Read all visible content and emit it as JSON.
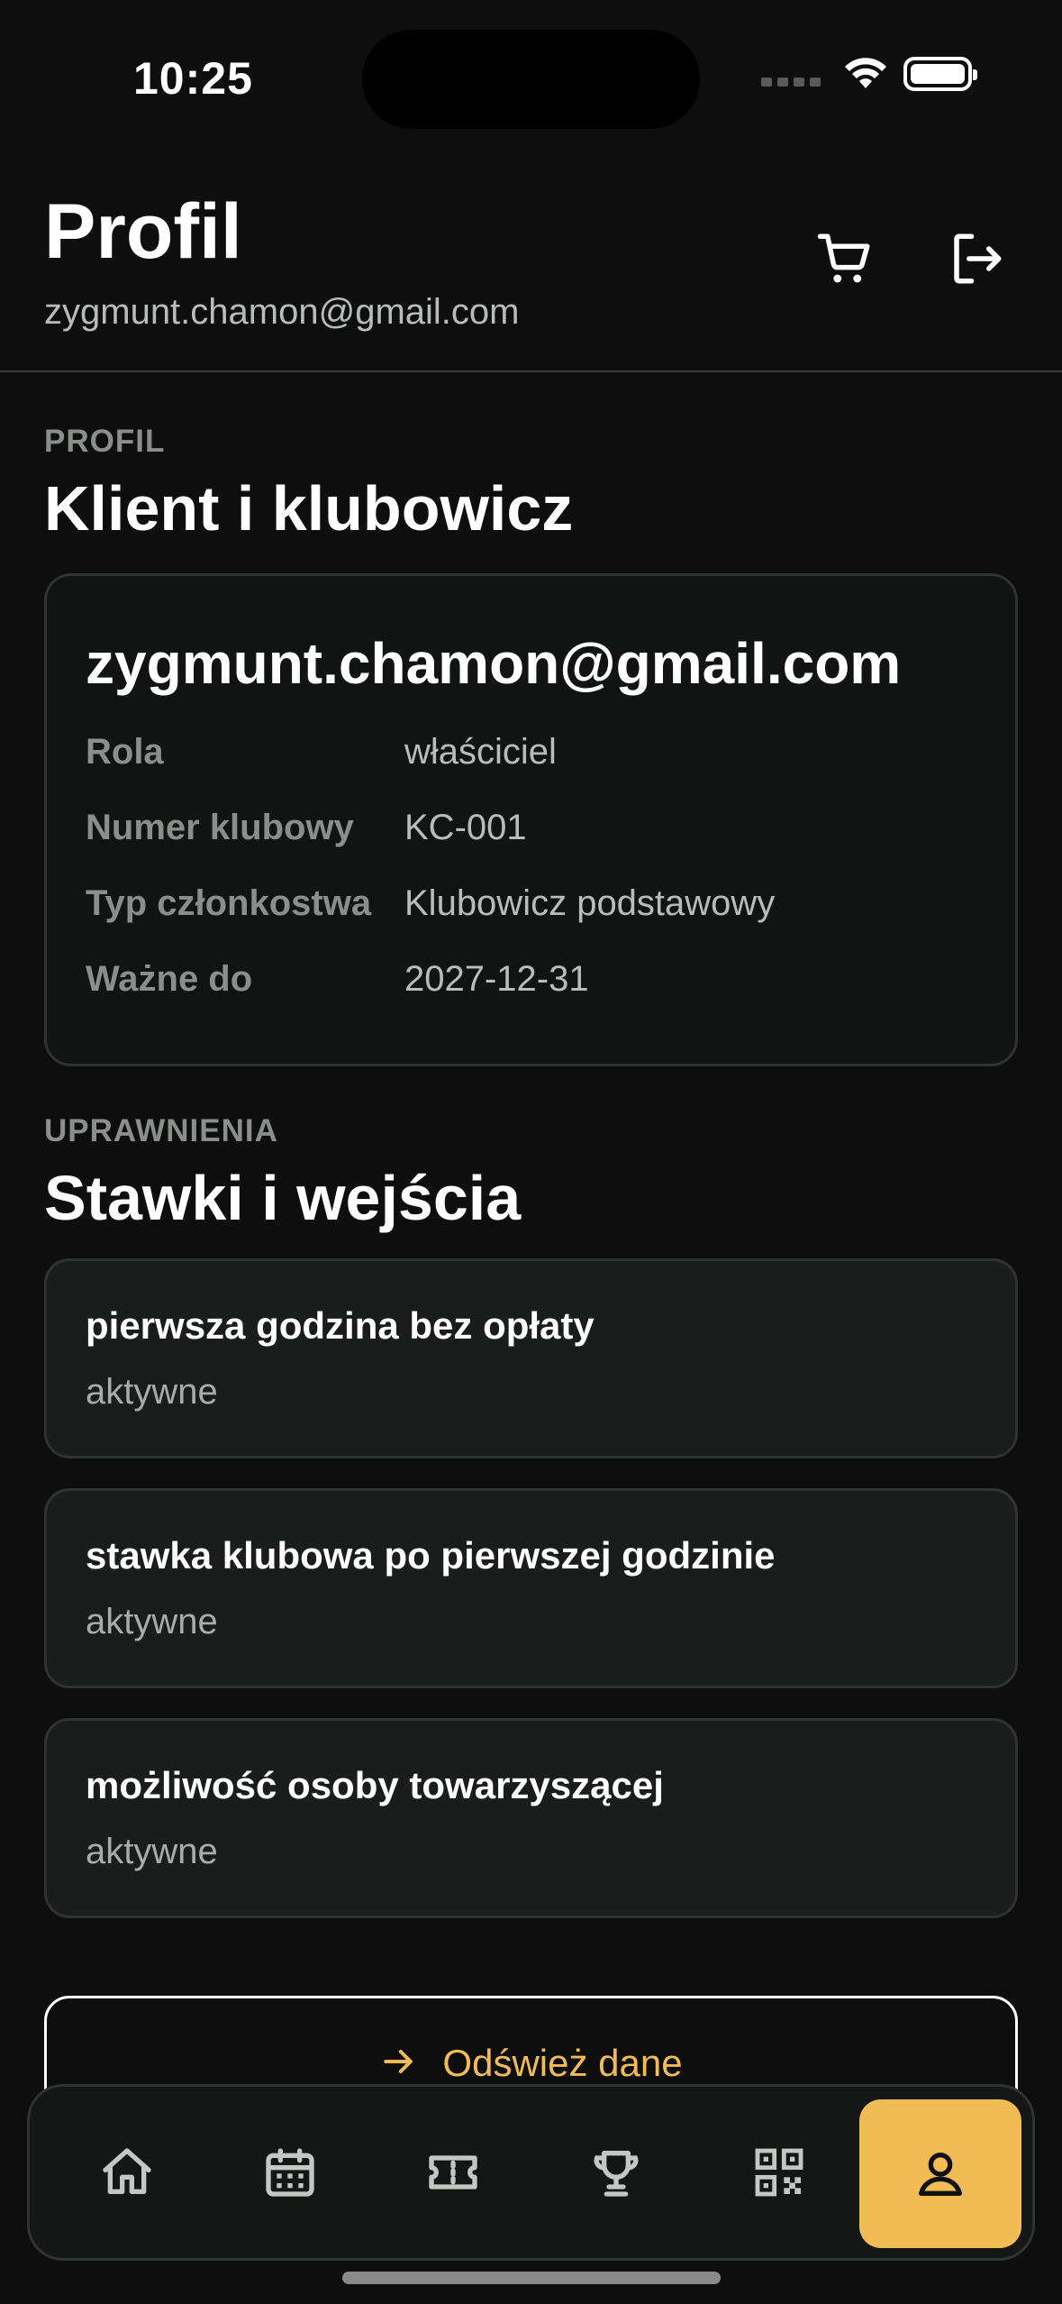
{
  "status_bar": {
    "time": "10:25"
  },
  "header": {
    "title": "Profil",
    "email": "zygmunt.chamon@gmail.com",
    "icons": [
      "cart-icon",
      "logout-icon"
    ]
  },
  "profile_section": {
    "eyebrow": "PROFIL",
    "title": "Klient i klubowicz",
    "card": {
      "email": "zygmunt.chamon@gmail.com",
      "rows": [
        {
          "label": "Rola",
          "value": "właściciel"
        },
        {
          "label": "Numer klubowy",
          "value": "KC-001"
        },
        {
          "label": "Typ członkostwa",
          "value": "Klubowicz podstawowy"
        },
        {
          "label": "Ważne do",
          "value": "2027-12-31"
        }
      ]
    }
  },
  "permissions_section": {
    "eyebrow": "UPRAWNIENIA",
    "title": "Stawki i wejścia",
    "items": [
      {
        "title": "pierwsza godzina bez opłaty",
        "status": "aktywne"
      },
      {
        "title": "stawka klubowa po pierwszej godzinie",
        "status": "aktywne"
      },
      {
        "title": "możliwość osoby towarzyszącej",
        "status": "aktywne"
      }
    ]
  },
  "refresh_button": {
    "label": "Odśwież dane"
  },
  "bottom_nav": {
    "items": [
      "home-icon",
      "calendar-icon",
      "ticket-icon",
      "trophy-icon",
      "qr-code-icon",
      "profile-icon"
    ],
    "active": "profile-icon"
  },
  "colors": {
    "background": "#0e0e0e",
    "accent": "#f2bc55",
    "card_border": "#2f3331",
    "muted_text": "#8a8f8c"
  }
}
